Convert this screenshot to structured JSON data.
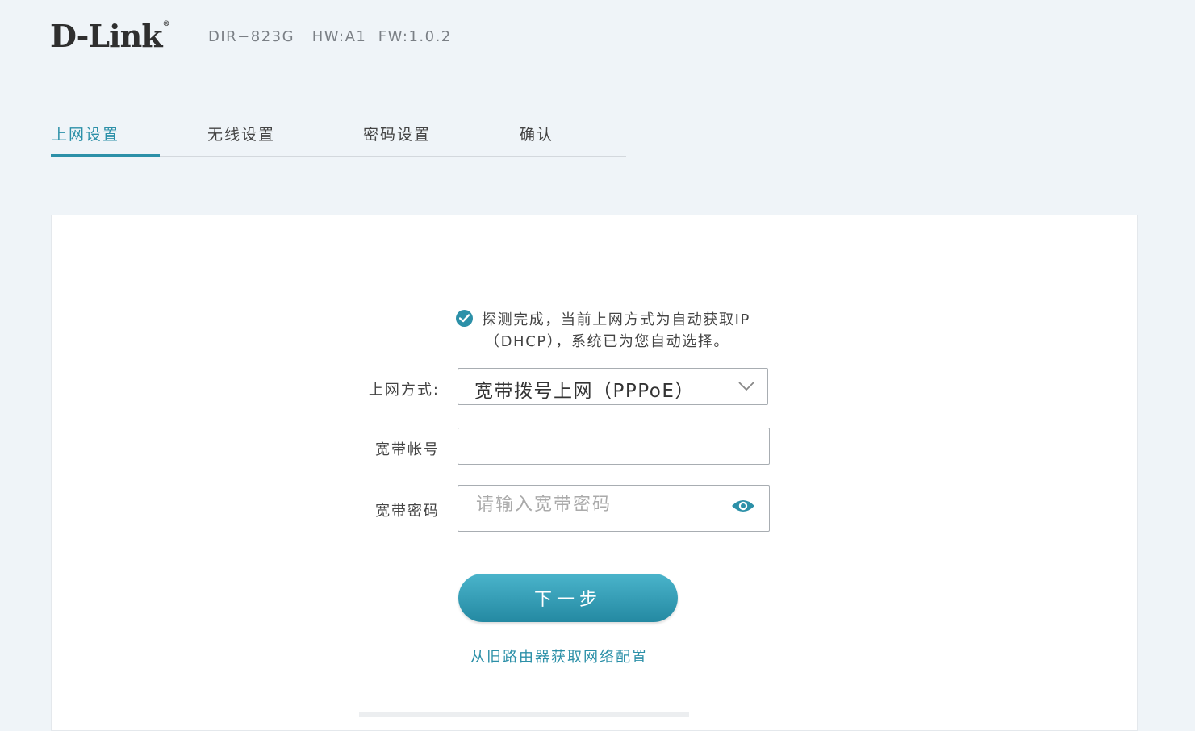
{
  "header": {
    "logo": "D-Link",
    "logo_mark": "®",
    "model": "DIR−823G",
    "hw": "HW:A1",
    "fw": "FW:1.0.2"
  },
  "tabs": [
    {
      "label": "上网设置",
      "active": true
    },
    {
      "label": "无线设置",
      "active": false
    },
    {
      "label": "密码设置",
      "active": false
    },
    {
      "label": "确认",
      "active": false
    }
  ],
  "notice": {
    "icon": "check-circle-icon",
    "line1": "探测完成，当前上网方式为自动获取IP",
    "line2": "（DHCP），系统已为您自动选择。"
  },
  "form": {
    "mode_label": "上网方式:",
    "mode_value": "宽带拨号上网（PPPoE）",
    "account_label": "宽带帐号",
    "account_value": "",
    "password_label": "宽带密码",
    "password_placeholder": "请输入宽带密码",
    "password_toggle_icon": "eye-icon"
  },
  "actions": {
    "next_label": "下一步",
    "import_link": "从旧路由器获取网络配置"
  },
  "colors": {
    "accent": "#2c90a8",
    "background": "#eff4f8"
  }
}
